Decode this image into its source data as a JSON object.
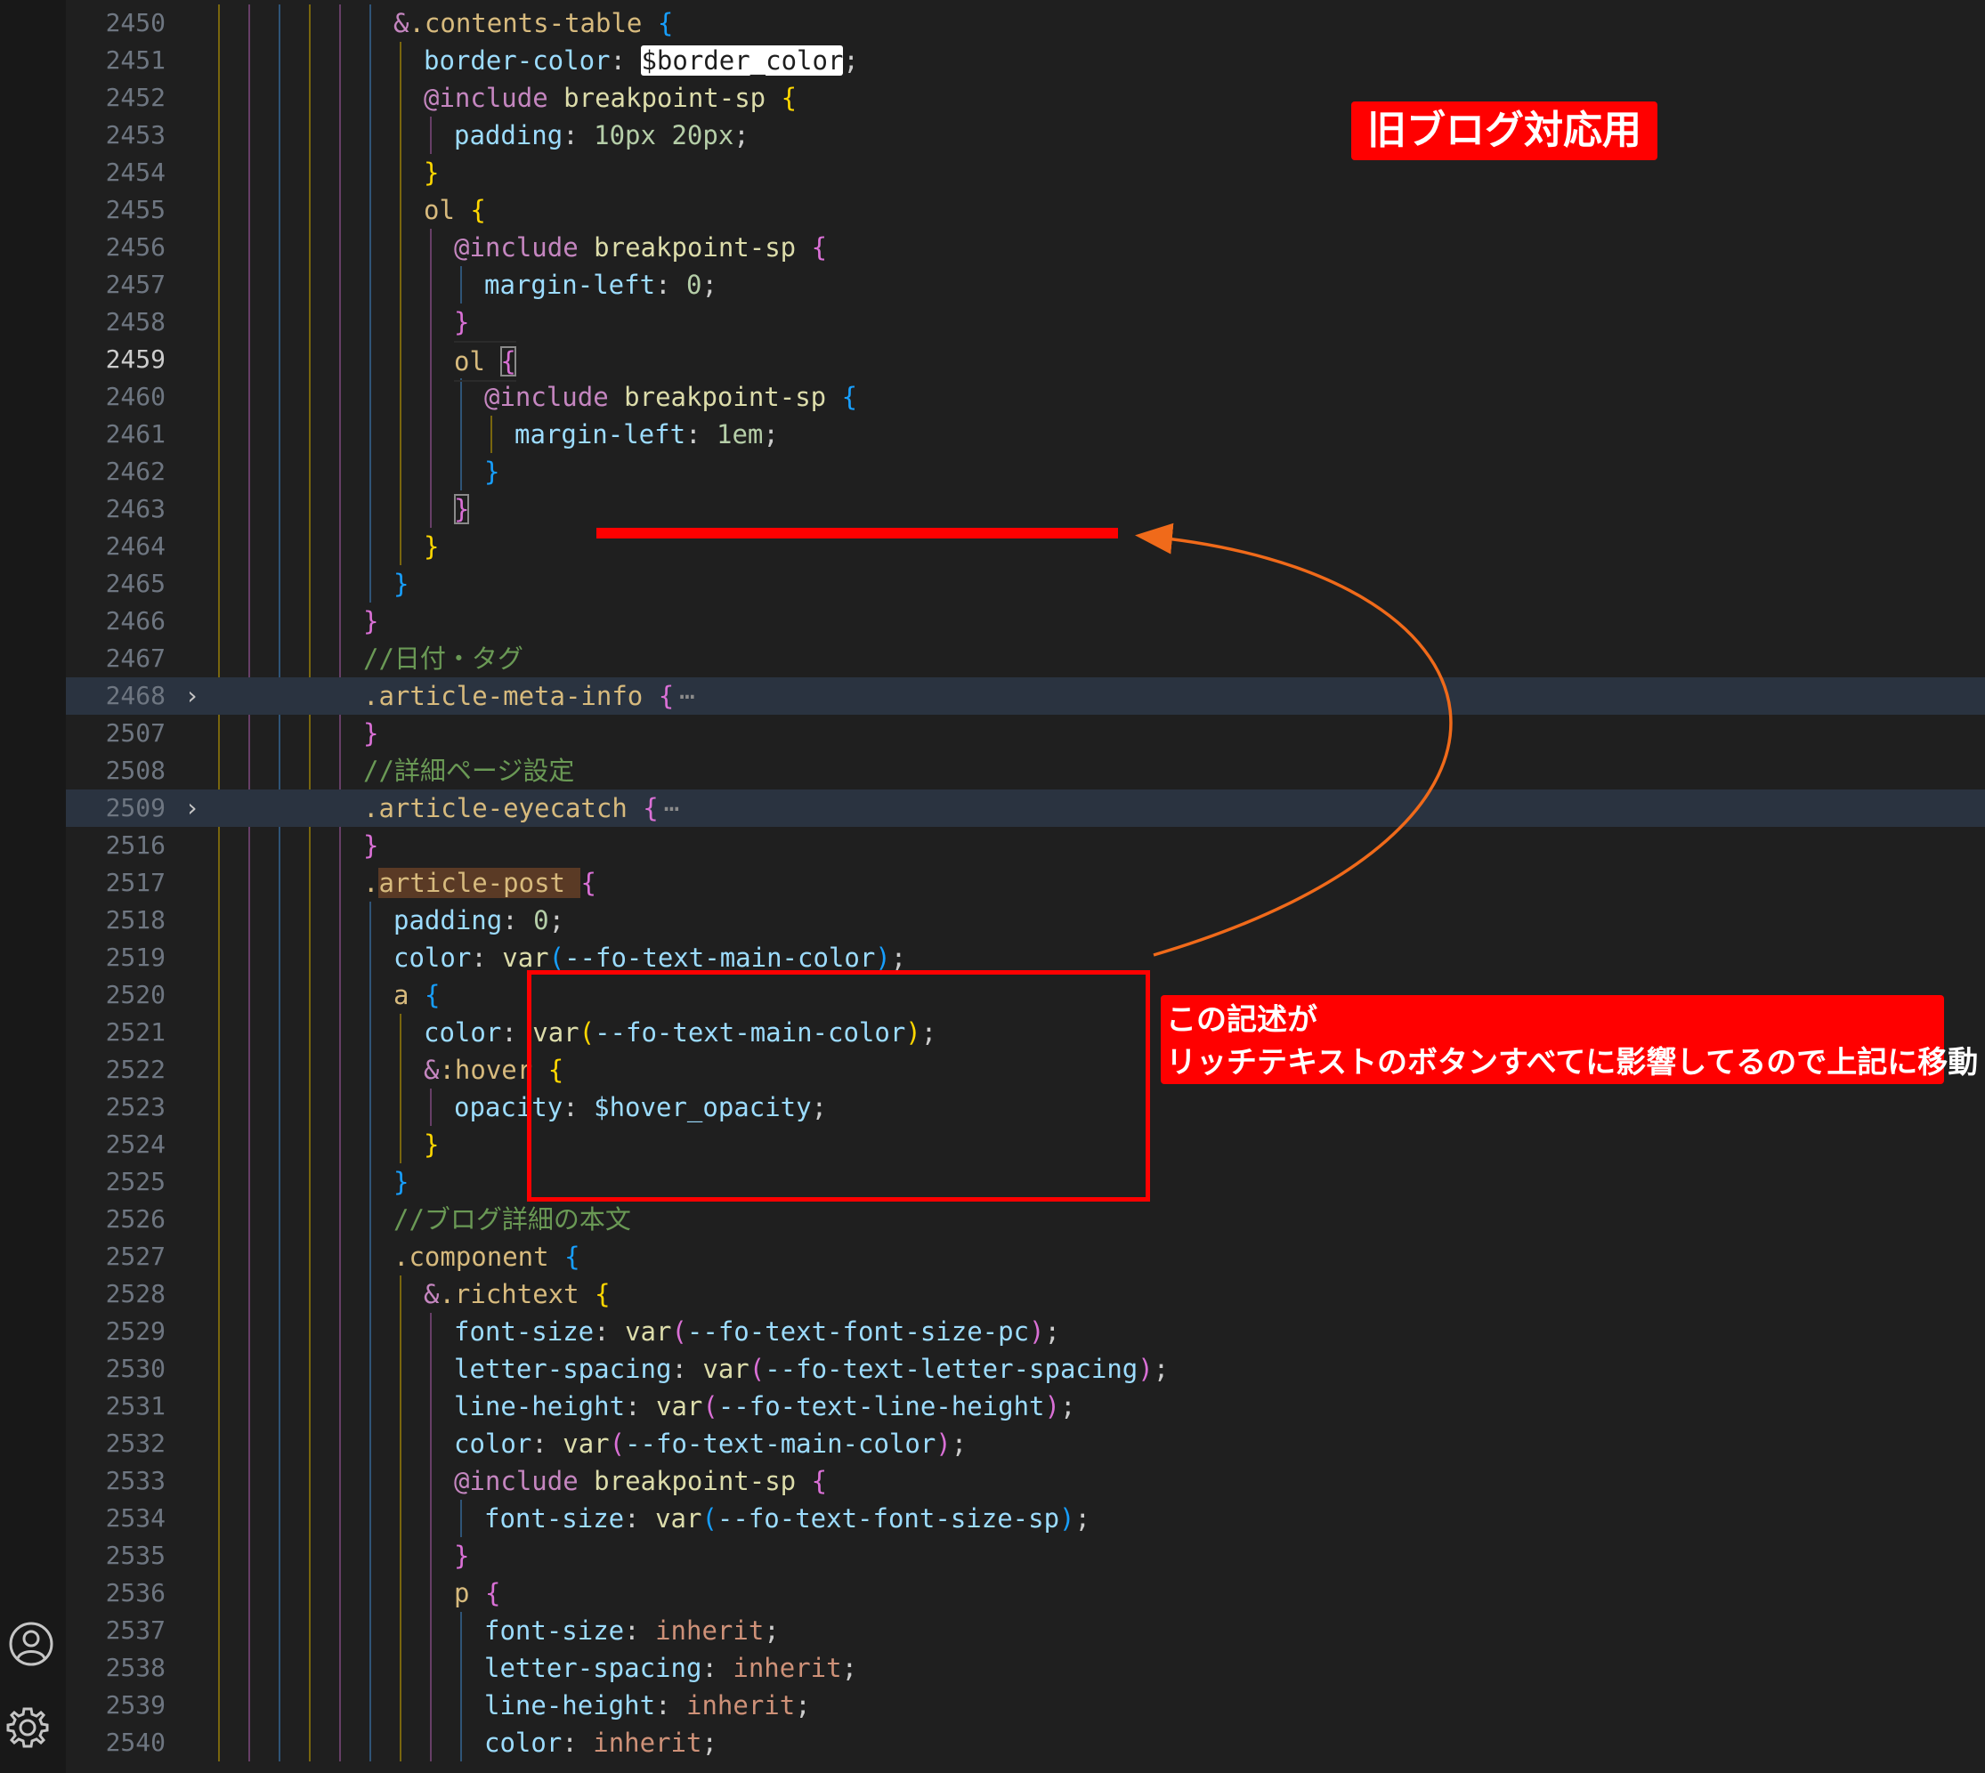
{
  "editor": {
    "lines": [
      {
        "no": "2450",
        "indent": 6,
        "tokens": [
          [
            "&",
            "k"
          ],
          [
            ".contents-table",
            "s"
          ],
          [
            " ",
            ""
          ],
          [
            "{",
            "b3"
          ]
        ]
      },
      {
        "no": "2451",
        "indent": 7,
        "tokens": [
          [
            "border-color",
            "p"
          ],
          [
            ": ",
            ""
          ],
          [
            "$border_color",
            "hv"
          ],
          [
            ";",
            ""
          ]
        ]
      },
      {
        "no": "2452",
        "indent": 7,
        "tokens": [
          [
            "@include",
            "k"
          ],
          [
            " ",
            ""
          ],
          [
            "breakpoint-sp",
            "f"
          ],
          [
            " ",
            ""
          ],
          [
            "{",
            "b1"
          ]
        ]
      },
      {
        "no": "2453",
        "indent": 8,
        "tokens": [
          [
            "padding",
            "p"
          ],
          [
            ": ",
            ""
          ],
          [
            "10px",
            "n"
          ],
          [
            " ",
            ""
          ],
          [
            "20px",
            "n"
          ],
          [
            ";",
            ""
          ]
        ]
      },
      {
        "no": "2454",
        "indent": 7,
        "tokens": [
          [
            "}",
            "b1"
          ]
        ]
      },
      {
        "no": "2455",
        "indent": 7,
        "tokens": [
          [
            "ol",
            "t"
          ],
          [
            " ",
            ""
          ],
          [
            "{",
            "b1"
          ]
        ]
      },
      {
        "no": "2456",
        "indent": 8,
        "tokens": [
          [
            "@include",
            "k"
          ],
          [
            " ",
            ""
          ],
          [
            "breakpoint-sp",
            "f"
          ],
          [
            " ",
            ""
          ],
          [
            "{",
            "b2"
          ]
        ]
      },
      {
        "no": "2457",
        "indent": 9,
        "tokens": [
          [
            "margin-left",
            "p"
          ],
          [
            ": ",
            ""
          ],
          [
            "0",
            "n"
          ],
          [
            ";",
            ""
          ]
        ]
      },
      {
        "no": "2458",
        "indent": 8,
        "tokens": [
          [
            "}",
            "b2"
          ]
        ]
      },
      {
        "no": "2459",
        "indent": 8,
        "current": true,
        "tokens": [
          [
            "ol",
            "t"
          ],
          [
            " ",
            ""
          ],
          [
            "{",
            "b2c"
          ]
        ]
      },
      {
        "no": "2460",
        "indent": 9,
        "tokens": [
          [
            "@include",
            "k"
          ],
          [
            " ",
            ""
          ],
          [
            "breakpoint-sp",
            "f"
          ],
          [
            " ",
            ""
          ],
          [
            "{",
            "b3"
          ]
        ]
      },
      {
        "no": "2461",
        "indent": 10,
        "tokens": [
          [
            "margin-left",
            "p"
          ],
          [
            ": ",
            ""
          ],
          [
            "1em",
            "n"
          ],
          [
            ";",
            ""
          ]
        ]
      },
      {
        "no": "2462",
        "indent": 9,
        "tokens": [
          [
            "}",
            "b3"
          ]
        ]
      },
      {
        "no": "2463",
        "indent": 8,
        "tokens": [
          [
            "}",
            "b2c"
          ]
        ]
      },
      {
        "no": "2464",
        "indent": 7,
        "tokens": [
          [
            "}",
            "b1"
          ]
        ]
      },
      {
        "no": "2465",
        "indent": 6,
        "tokens": [
          [
            "}",
            "b3"
          ]
        ]
      },
      {
        "no": "2466",
        "indent": 5,
        "tokens": [
          [
            "}",
            "b2"
          ]
        ]
      },
      {
        "no": "2467",
        "indent": 5,
        "tokens": [
          [
            "//日付・タグ",
            "c"
          ]
        ]
      },
      {
        "no": "2468",
        "indent": 5,
        "folded": true,
        "tokens": [
          [
            ".article-meta-info",
            "s"
          ],
          [
            " ",
            ""
          ],
          [
            "{",
            "b2"
          ]
        ]
      },
      {
        "no": "2507",
        "indent": 5,
        "tokens": [
          [
            "}",
            "b2"
          ]
        ]
      },
      {
        "no": "2508",
        "indent": 5,
        "tokens": [
          [
            "//詳細ページ設定",
            "c"
          ]
        ]
      },
      {
        "no": "2509",
        "indent": 5,
        "folded": true,
        "tokens": [
          [
            ".article-eyecatch",
            "s"
          ],
          [
            " ",
            ""
          ],
          [
            "{",
            "b2"
          ]
        ]
      },
      {
        "no": "2516",
        "indent": 5,
        "tokens": [
          [
            "}",
            "b2"
          ]
        ]
      },
      {
        "no": "2517",
        "indent": 5,
        "tokens": [
          [
            ".",
            "s"
          ],
          [
            "article-post",
            "sh"
          ],
          [
            " ",
            "sh"
          ],
          [
            "{",
            "b2"
          ]
        ]
      },
      {
        "no": "2518",
        "indent": 6,
        "tokens": [
          [
            "padding",
            "p"
          ],
          [
            ": ",
            ""
          ],
          [
            "0",
            "n"
          ],
          [
            ";",
            ""
          ]
        ]
      },
      {
        "no": "2519",
        "indent": 6,
        "tokens": [
          [
            "color",
            "p"
          ],
          [
            ": ",
            ""
          ],
          [
            "var",
            "f"
          ],
          [
            "(",
            "b3"
          ],
          [
            "--fo-text-main-color",
            "v"
          ],
          [
            ")",
            "b3"
          ],
          [
            ";",
            ""
          ]
        ]
      },
      {
        "no": "2520",
        "indent": 6,
        "tokens": [
          [
            "a",
            "t"
          ],
          [
            " ",
            ""
          ],
          [
            "{",
            "b3"
          ]
        ]
      },
      {
        "no": "2521",
        "indent": 7,
        "tokens": [
          [
            "color",
            "p"
          ],
          [
            ": ",
            ""
          ],
          [
            "var",
            "f"
          ],
          [
            "(",
            "b1"
          ],
          [
            "--fo-text-main-color",
            "v"
          ],
          [
            ")",
            "b1"
          ],
          [
            ";",
            ""
          ]
        ]
      },
      {
        "no": "2522",
        "indent": 7,
        "tokens": [
          [
            "&",
            "k"
          ],
          [
            ":hover",
            "t"
          ],
          [
            " ",
            ""
          ],
          [
            "{",
            "b1"
          ]
        ]
      },
      {
        "no": "2523",
        "indent": 8,
        "tokens": [
          [
            "opacity",
            "p"
          ],
          [
            ": ",
            ""
          ],
          [
            "$hover_opacity",
            "v"
          ],
          [
            ";",
            ""
          ]
        ]
      },
      {
        "no": "2524",
        "indent": 7,
        "tokens": [
          [
            "}",
            "b1"
          ]
        ]
      },
      {
        "no": "2525",
        "indent": 6,
        "tokens": [
          [
            "}",
            "b3"
          ]
        ]
      },
      {
        "no": "2526",
        "indent": 6,
        "tokens": [
          [
            "//ブログ詳細の本文",
            "c"
          ]
        ]
      },
      {
        "no": "2527",
        "indent": 6,
        "tokens": [
          [
            ".component",
            "s"
          ],
          [
            " ",
            ""
          ],
          [
            "{",
            "b3"
          ]
        ]
      },
      {
        "no": "2528",
        "indent": 7,
        "tokens": [
          [
            "&",
            "k"
          ],
          [
            ".richtext",
            "s"
          ],
          [
            " ",
            ""
          ],
          [
            "{",
            "b1"
          ]
        ]
      },
      {
        "no": "2529",
        "indent": 8,
        "tokens": [
          [
            "font-size",
            "p"
          ],
          [
            ": ",
            ""
          ],
          [
            "var",
            "f"
          ],
          [
            "(",
            "b2"
          ],
          [
            "--fo-text-font-size-pc",
            "v"
          ],
          [
            ")",
            "b2"
          ],
          [
            ";",
            ""
          ]
        ]
      },
      {
        "no": "2530",
        "indent": 8,
        "tokens": [
          [
            "letter-spacing",
            "p"
          ],
          [
            ": ",
            ""
          ],
          [
            "var",
            "f"
          ],
          [
            "(",
            "b2"
          ],
          [
            "--fo-text-letter-spacing",
            "v"
          ],
          [
            ")",
            "b2"
          ],
          [
            ";",
            ""
          ]
        ]
      },
      {
        "no": "2531",
        "indent": 8,
        "tokens": [
          [
            "line-height",
            "p"
          ],
          [
            ": ",
            ""
          ],
          [
            "var",
            "f"
          ],
          [
            "(",
            "b2"
          ],
          [
            "--fo-text-line-height",
            "v"
          ],
          [
            ")",
            "b2"
          ],
          [
            ";",
            ""
          ]
        ]
      },
      {
        "no": "2532",
        "indent": 8,
        "tokens": [
          [
            "color",
            "p"
          ],
          [
            ": ",
            ""
          ],
          [
            "var",
            "f"
          ],
          [
            "(",
            "b2"
          ],
          [
            "--fo-text-main-color",
            "v"
          ],
          [
            ")",
            "b2"
          ],
          [
            ";",
            ""
          ]
        ]
      },
      {
        "no": "2533",
        "indent": 8,
        "tokens": [
          [
            "@include",
            "k"
          ],
          [
            " ",
            ""
          ],
          [
            "breakpoint-sp",
            "f"
          ],
          [
            " ",
            ""
          ],
          [
            "{",
            "b2"
          ]
        ]
      },
      {
        "no": "2534",
        "indent": 9,
        "tokens": [
          [
            "font-size",
            "p"
          ],
          [
            ": ",
            ""
          ],
          [
            "var",
            "f"
          ],
          [
            "(",
            "b3"
          ],
          [
            "--fo-text-font-size-sp",
            "v"
          ],
          [
            ")",
            "b3"
          ],
          [
            ";",
            ""
          ]
        ]
      },
      {
        "no": "2535",
        "indent": 8,
        "tokens": [
          [
            "}",
            "b2"
          ]
        ]
      },
      {
        "no": "2536",
        "indent": 8,
        "tokens": [
          [
            "p",
            "t"
          ],
          [
            " ",
            ""
          ],
          [
            "{",
            "b2"
          ]
        ]
      },
      {
        "no": "2537",
        "indent": 9,
        "tokens": [
          [
            "font-size",
            "p"
          ],
          [
            ": ",
            ""
          ],
          [
            "inherit",
            "kw"
          ],
          [
            ";",
            ""
          ]
        ]
      },
      {
        "no": "2538",
        "indent": 9,
        "tokens": [
          [
            "letter-spacing",
            "p"
          ],
          [
            ": ",
            ""
          ],
          [
            "inherit",
            "kw"
          ],
          [
            ";",
            ""
          ]
        ]
      },
      {
        "no": "2539",
        "indent": 9,
        "tokens": [
          [
            "line-height",
            "p"
          ],
          [
            ": ",
            ""
          ],
          [
            "inherit",
            "kw"
          ],
          [
            ";",
            ""
          ]
        ]
      },
      {
        "no": "2540",
        "indent": 9,
        "tokens": [
          [
            "color",
            "p"
          ],
          [
            ": ",
            ""
          ],
          [
            "inherit",
            "kw"
          ],
          [
            ";",
            ""
          ]
        ]
      }
    ],
    "fold_marker": "›",
    "fold_ellipsis": "⋯"
  },
  "annotations": {
    "old_blog_badge": "旧ブログ対応用",
    "move_note_line1": "この記述が",
    "move_note_line2": "リッチテキストのボタンすべてに影響してるので上記に移動"
  },
  "activity_bar": {
    "icons": [
      "account-icon",
      "gear-icon"
    ]
  },
  "colors": {
    "background": "#1f1f1f",
    "line_number": "#6e7681",
    "annotation_red": "#ff0000",
    "arrow_orange": "#f06a1a",
    "selector": "#d7ba7d",
    "property": "#9cdcfe",
    "keyword": "#c586c0",
    "function": "#dcdcaa",
    "number": "#b5cea8",
    "comment": "#6a9955",
    "value_keyword": "#ce9178",
    "tag": "#d7ba7d",
    "bracket_gold": "#ffd700",
    "bracket_pink": "#da70d6",
    "bracket_blue": "#179fff"
  }
}
